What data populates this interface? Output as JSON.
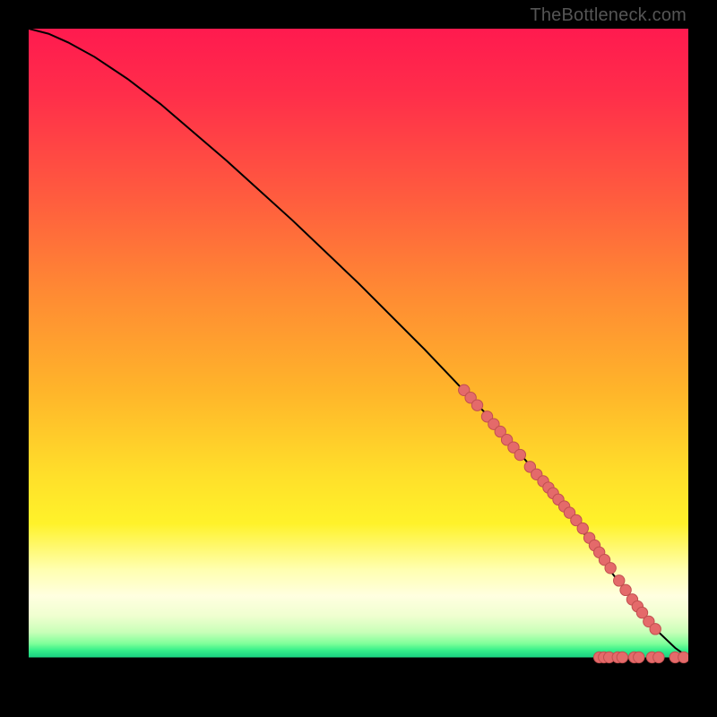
{
  "watermark": "TheBottleneck.com",
  "colors": {
    "frame": "#000000",
    "curve": "#000000",
    "dot_fill": "#e46a6a",
    "dot_stroke": "#c14f4f"
  },
  "chart_data": {
    "type": "line",
    "title": "",
    "xlabel": "",
    "ylabel": "",
    "xlim": [
      0,
      100
    ],
    "ylim": [
      0,
      100
    ],
    "curve": {
      "x": [
        0,
        3,
        6,
        10,
        15,
        20,
        30,
        40,
        50,
        60,
        70,
        78,
        84,
        88,
        92,
        95,
        98,
        100
      ],
      "y": [
        100,
        99.2,
        97.8,
        95.5,
        92,
        88,
        79,
        69.5,
        59.5,
        49,
        38,
        28,
        20,
        14,
        8.5,
        4.5,
        1.5,
        0
      ]
    },
    "scatter_on_curve": {
      "note": "points lie on the curve; lower-right cluster plus tail along y≈0",
      "x": [
        66,
        67,
        68,
        69.5,
        70.5,
        71.5,
        72.5,
        73.5,
        74.5,
        76,
        77,
        78,
        78.8,
        79.5,
        80.3,
        81.2,
        82,
        83,
        84,
        85,
        85.8,
        86.5,
        87.3,
        88.2,
        89.5,
        90.5,
        91.5,
        92.3,
        93,
        94,
        95,
        86.5,
        87.2,
        88,
        89.3,
        90,
        91.8,
        92.5,
        94.5,
        95.5,
        98,
        99.3
      ],
      "y": [
        42.5,
        41.3,
        40.1,
        38.3,
        37.1,
        35.9,
        34.6,
        33.4,
        32.2,
        30.3,
        29.1,
        28,
        27,
        26.1,
        25.1,
        24,
        23,
        21.8,
        20.5,
        19,
        17.8,
        16.7,
        15.5,
        14.2,
        12.2,
        10.7,
        9.2,
        8.1,
        7.1,
        5.7,
        4.5,
        0,
        0,
        0,
        0,
        0,
        0,
        0,
        0,
        0,
        0,
        0
      ]
    }
  }
}
